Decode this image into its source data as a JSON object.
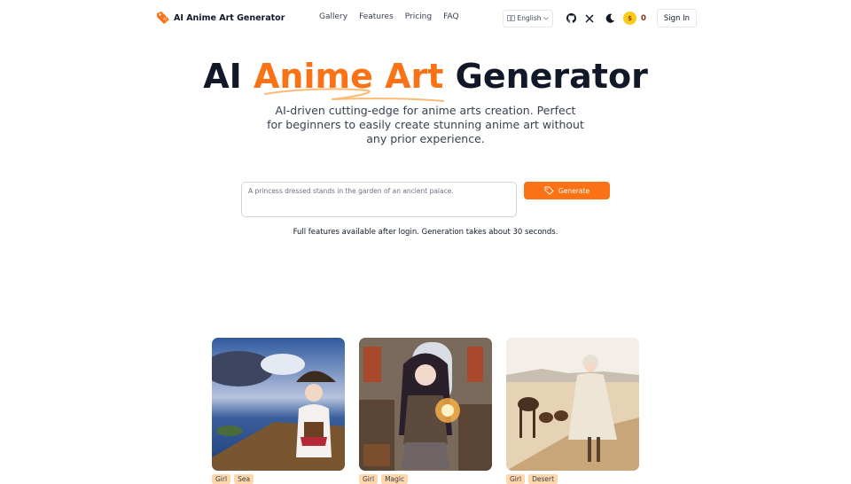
{
  "header": {
    "brand_name": "AI Anime Art Generator",
    "logo_text": "AI",
    "nav": [
      {
        "label": "Gallery"
      },
      {
        "label": "Features"
      },
      {
        "label": "Pricing"
      },
      {
        "label": "FAQ"
      }
    ],
    "language": "English",
    "coin_symbol": "$",
    "credits": "0",
    "signin_label": "Sign In",
    "icons": [
      "language-icon",
      "github-icon",
      "x-icon",
      "moon-icon",
      "coin-icon"
    ]
  },
  "hero": {
    "title_part1": "AI",
    "title_accent": "Anime Art",
    "title_part2": "Generator",
    "subtitle": "AI-driven cutting-edge for anime arts creation. Perfect for beginners to easily create stunning anime art without any prior experience."
  },
  "generator": {
    "placeholder": "A princess dressed stands in the garden of an ancient palace.",
    "value": "",
    "button_label": "Generate",
    "hint": "Full features available after login. Generation takes about 30 seconds."
  },
  "colors": {
    "accent": "#f97316",
    "tag_bg": "#fed7aa",
    "title": "#111827"
  },
  "gallery": [
    {
      "alt": "Pirate girl on a ship deck by the sea",
      "tags": [
        "Girl",
        "Sea"
      ]
    },
    {
      "alt": "Girl casting magic in a library",
      "tags": [
        "Girl",
        "Magic"
      ]
    },
    {
      "alt": "Girl walking through desert with camels",
      "tags": [
        "Girl",
        "Desert"
      ]
    }
  ]
}
